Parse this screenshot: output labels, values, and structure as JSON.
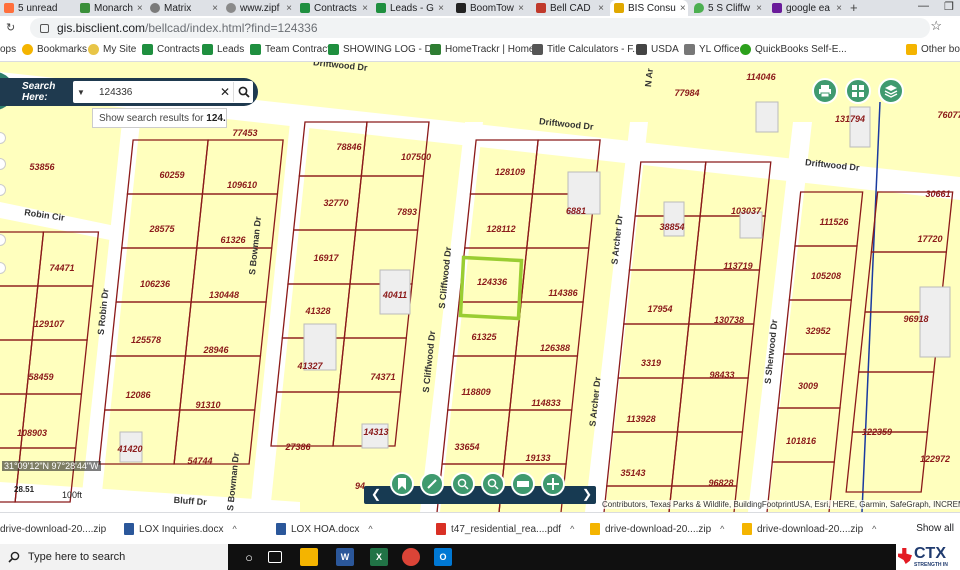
{
  "tabs": [
    {
      "label": "5 unread",
      "color": "#ff6f3c",
      "active": false
    },
    {
      "label": "Monarch",
      "color": "#3a8f3a",
      "active": false
    },
    {
      "label": "Matrix",
      "color": "#7a7a7a",
      "active": false
    },
    {
      "label": "www.zipf",
      "color": "#8a8a8a",
      "active": false
    },
    {
      "label": "Contracts",
      "color": "#1f8f3f",
      "active": false
    },
    {
      "label": "Leads - G",
      "color": "#1f8f3f",
      "active": false
    },
    {
      "label": "BoomTow",
      "color": "#222222",
      "active": false
    },
    {
      "label": "Bell CAD",
      "color": "#c0392b",
      "active": false
    },
    {
      "label": "BIS Consu",
      "color": "#e0a800",
      "active": true
    },
    {
      "label": "5 S Cliffw",
      "color": "#4caf50",
      "active": false
    },
    {
      "label": "google ea",
      "color": "#6a1b9a",
      "active": false
    }
  ],
  "address": {
    "host": "gis.bisclient.com",
    "path": "/bellcad/index.html?find=124336"
  },
  "bookmarks": [
    {
      "label": "ops",
      "color": "#666666"
    },
    {
      "label": "Bookmarks",
      "color": "#f4b400"
    },
    {
      "label": "My Site",
      "color": "#e8c547"
    },
    {
      "label": "Contracts",
      "color": "#1f8f3f"
    },
    {
      "label": "Leads",
      "color": "#1f8f3f"
    },
    {
      "label": "Team Contract",
      "color": "#1f8f3f"
    },
    {
      "label": "SHOWING LOG - D...",
      "color": "#1f8f3f"
    },
    {
      "label": "HomeTrackr | Home...",
      "color": "#2e7d32"
    },
    {
      "label": "Title Calculators - F...",
      "color": "#555555"
    },
    {
      "label": "USDA",
      "color": "#444444"
    },
    {
      "label": "YL Office",
      "color": "#777777"
    },
    {
      "label": "QuickBooks Self-E...",
      "color": "#2ca01c"
    },
    {
      "label": "Other bo",
      "color": "#f4b400"
    }
  ],
  "search": {
    "label": "Search Here:",
    "value": "124336",
    "suggest_prefix": "Show search results for ",
    "suggest_value": "124..."
  },
  "map": {
    "streets": [
      "Driftwood Dr",
      "Driftwood Dr",
      "Driftwood Dr",
      "Robin Cir",
      "S Robin Dr",
      "S Bowman Dr",
      "S Bowman Dr",
      "S Cliffwood Dr",
      "S Cliffwood Dr",
      "S Archer Dr",
      "S Archer Dr",
      "S Sherwood Dr",
      "Bluff Dr",
      "N Ar"
    ],
    "parcels": [
      "114046",
      "77984",
      "131794",
      "76077",
      "77453",
      "78846",
      "107500",
      "128109",
      "6881",
      "53856",
      "60259",
      "109610",
      "32770",
      "7893",
      "128112",
      "38854",
      "103037",
      "111526",
      "30661",
      "17720",
      "28575",
      "61326",
      "16917",
      "124336",
      "114386",
      "113719",
      "105208",
      "74471",
      "106236",
      "130448",
      "41328",
      "40411",
      "17954",
      "130738",
      "96918",
      "129107",
      "125578",
      "28946",
      "61325",
      "126388",
      "32952",
      "41327",
      "74371",
      "3319",
      "98433",
      "3009",
      "58459",
      "12086",
      "91310",
      "118809",
      "114833",
      "113928",
      "101816",
      "122359",
      "108903",
      "41420",
      "14313",
      "33654",
      "19133",
      "27386",
      "54744",
      "35143",
      "96828",
      "122972",
      "94"
    ],
    "coords": "31°09'12\"N 97°28'44\"W",
    "scale_label": "100ft",
    "scale_small": "28.51",
    "attribution": "Contributors, Texas Parks & Wildlife, BuildingFootprintUSA, Esri, HERE, Garmin, SafeGraph, INCREMENT P,"
  },
  "downloads": [
    {
      "label": "drive-download-20....zip",
      "color": "#f4b400"
    },
    {
      "label": "LOX Inquiries.docx",
      "color": "#2b579a"
    },
    {
      "label": "LOX HOA.docx",
      "color": "#2b579a"
    },
    {
      "label": "t47_residential_rea....pdf",
      "color": "#d93025"
    },
    {
      "label": "drive-download-20....zip",
      "color": "#f4b400"
    },
    {
      "label": "drive-download-20....zip",
      "color": "#f4b400"
    }
  ],
  "show_all": "Show all",
  "taskbar": {
    "search_placeholder": "Type here to search"
  },
  "brand": {
    "name": "CTX",
    "tagline": "STRENGTH IN"
  }
}
